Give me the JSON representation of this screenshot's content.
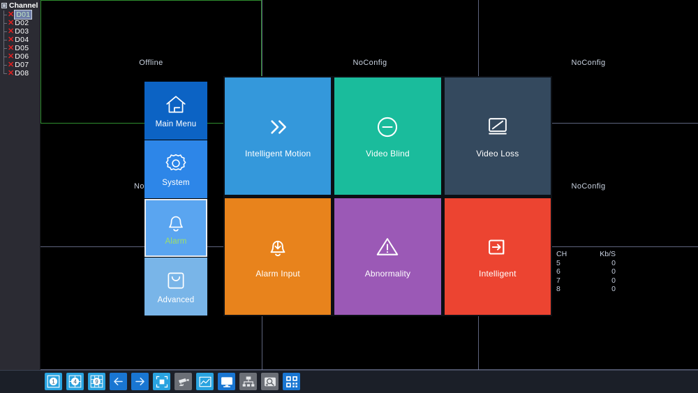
{
  "channel_panel": {
    "title": "Channel",
    "expander_icon": "collapse-box-icon",
    "items": [
      {
        "name": "D01",
        "status_icon": "red-x-icon",
        "selected": true
      },
      {
        "name": "D02",
        "status_icon": "red-x-icon",
        "selected": false
      },
      {
        "name": "D03",
        "status_icon": "red-x-icon",
        "selected": false
      },
      {
        "name": "D04",
        "status_icon": "red-x-icon",
        "selected": false
      },
      {
        "name": "D05",
        "status_icon": "red-x-icon",
        "selected": false
      },
      {
        "name": "D06",
        "status_icon": "red-x-icon",
        "selected": false
      },
      {
        "name": "D07",
        "status_icon": "red-x-icon",
        "selected": false
      },
      {
        "name": "D08",
        "status_icon": "red-x-icon",
        "selected": false
      }
    ]
  },
  "video_wall": {
    "cells": [
      {
        "label": "Offline",
        "selected": true
      },
      {
        "label": "NoConfig",
        "selected": false
      },
      {
        "label": "NoConfig",
        "selected": false
      },
      {
        "label": "NoConfig",
        "selected": false
      },
      {
        "label": "",
        "selected": false
      },
      {
        "label": "NoConfig",
        "selected": false
      },
      {
        "label": "",
        "selected": false
      },
      {
        "label": "",
        "selected": false
      },
      {
        "label": "",
        "selected": false
      }
    ]
  },
  "left_menu": {
    "items": [
      {
        "label": "Main Menu",
        "icon": "home-icon",
        "color": "#0c63c4",
        "selected": false
      },
      {
        "label": "System",
        "icon": "gear-icon",
        "color": "#2d86e8",
        "selected": false
      },
      {
        "label": "Alarm",
        "icon": "bell-icon",
        "color": "#5aa5f0",
        "selected": true
      },
      {
        "label": "Advanced",
        "icon": "toolbox-icon",
        "color": "#79b5e8",
        "selected": false
      }
    ]
  },
  "tiles": [
    {
      "label": "Intelligent Motion",
      "icon": "double-chevron-right-icon",
      "color": "#3498db"
    },
    {
      "label": "Video Blind",
      "icon": "circle-minus-icon",
      "color": "#1abc9c"
    },
    {
      "label": "Video Loss",
      "icon": "monitor-slash-icon",
      "color": "#34495e"
    },
    {
      "label": "Alarm Input",
      "icon": "bell-download-icon",
      "color": "#e8831c"
    },
    {
      "label": "Abnormality",
      "icon": "warning-triangle-icon",
      "color": "#9b59b6"
    },
    {
      "label": "Intelligent",
      "icon": "arrow-into-box-icon",
      "color": "#ec4431"
    }
  ],
  "bandwidth": {
    "header": {
      "channel": "CH",
      "rate": "Kb/S"
    },
    "rows": [
      {
        "channel": "5",
        "rate": "0"
      },
      {
        "channel": "6",
        "rate": "0"
      },
      {
        "channel": "7",
        "rate": "0"
      },
      {
        "channel": "8",
        "rate": "0"
      }
    ]
  },
  "taskbar": {
    "buttons": [
      {
        "name": "view-1-split-button",
        "icon": "view-1-icon",
        "label": "1",
        "style": "light"
      },
      {
        "name": "view-4-split-button",
        "icon": "view-4-icon",
        "label": "4",
        "style": "light"
      },
      {
        "name": "view-9-split-button",
        "icon": "view-9-icon",
        "label": "9",
        "style": "light"
      },
      {
        "name": "previous-page-button",
        "icon": "arrow-left-icon",
        "label": "",
        "style": "blue"
      },
      {
        "name": "next-page-button",
        "icon": "arrow-right-icon",
        "label": "",
        "style": "blue"
      },
      {
        "name": "tour-button",
        "icon": "tour-frame-icon",
        "label": "",
        "style": "light"
      },
      {
        "name": "ptz-button",
        "icon": "camera-icon",
        "label": "",
        "style": "grey"
      },
      {
        "name": "color-setting-button",
        "icon": "image-chart-icon",
        "label": "",
        "style": "light"
      },
      {
        "name": "output-adjust-button",
        "icon": "monitor-icon",
        "label": "",
        "style": "blue"
      },
      {
        "name": "remote-device-button",
        "icon": "network-tree-icon",
        "label": "",
        "style": "grey"
      },
      {
        "name": "record-search-button",
        "icon": "disk-search-icon",
        "label": "",
        "style": "grey"
      },
      {
        "name": "qr-code-button",
        "icon": "qr-code-icon",
        "label": "",
        "style": "blue"
      }
    ]
  },
  "colors": {
    "selection_green": "#3a9a3a",
    "divider": "#7d86a8",
    "panel_bg": "#2b2b33",
    "taskbar_bg": "#1b1f28"
  }
}
